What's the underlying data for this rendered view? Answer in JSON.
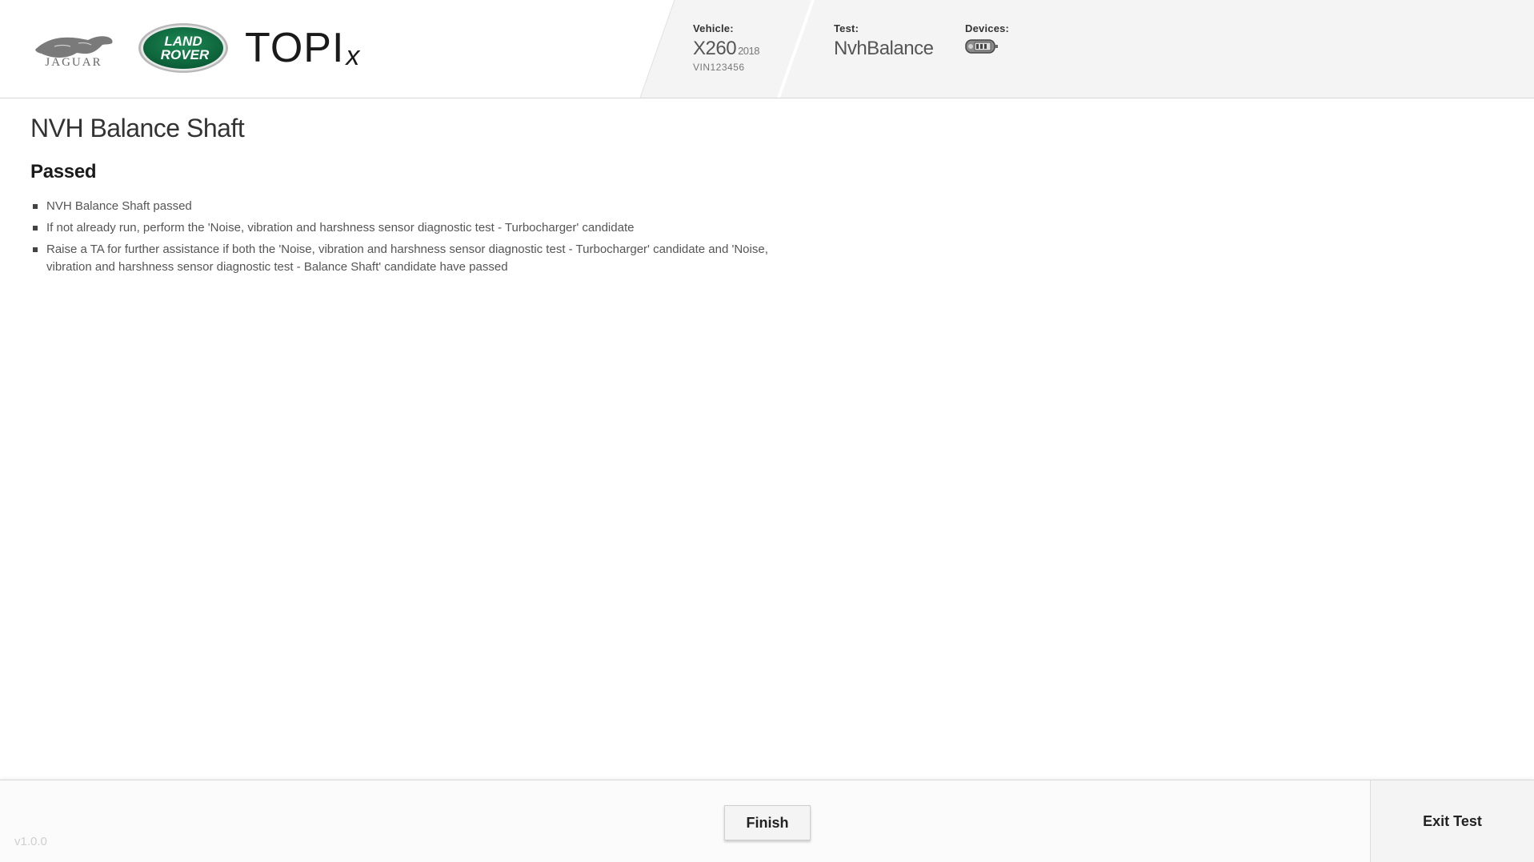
{
  "header": {
    "logos": {
      "jaguar_wordmark": "JAGUAR",
      "landrover_line1": "LAND",
      "landrover_line2": "ROVER",
      "topix_main": "TOPI",
      "topix_suffix": "x"
    },
    "vehicle": {
      "label": "Vehicle:",
      "model": "X260",
      "year": "2018",
      "vin": "VIN123456"
    },
    "test": {
      "label": "Test:",
      "name": "NvhBalance"
    },
    "devices": {
      "label": "Devices:",
      "icon": "vci-device-icon"
    },
    "colors": {
      "panel_bg": "#f4f4f4",
      "landrover_green": "#0a5c36"
    }
  },
  "main": {
    "title": "NVH Balance Shaft",
    "status": "Passed",
    "results": [
      "NVH Balance Shaft passed",
      "If not already run, perform the 'Noise, vibration and harshness sensor diagnostic test - Turbocharger' candidate",
      "Raise a TA for further assistance if both the 'Noise, vibration and harshness sensor diagnostic test - Turbocharger' candidate and 'Noise, vibration and harshness sensor diagnostic test - Balance Shaft' candidate have passed"
    ]
  },
  "footer": {
    "version": "v1.0.0",
    "finish_label": "Finish",
    "exit_label": "Exit Test"
  }
}
